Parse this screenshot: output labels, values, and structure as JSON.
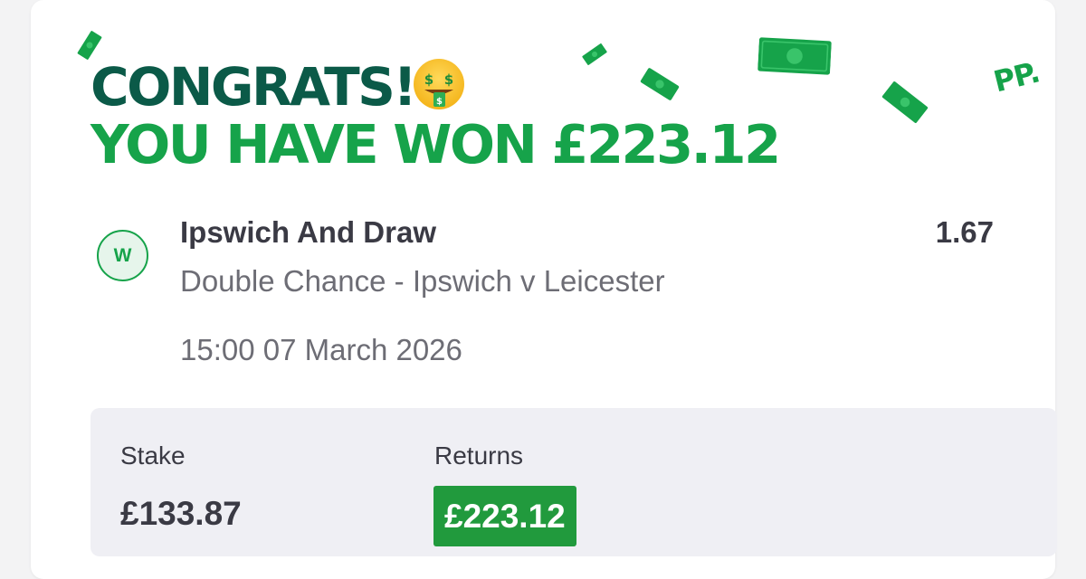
{
  "banner": {
    "line1": "CONGRATS!",
    "line2": "YOU HAVE WON £223.12",
    "emoji_icon": "money-mouth-face-icon",
    "decoration_icon": "banknote-icon",
    "logo_text": "PP."
  },
  "bet": {
    "status_badge": "W",
    "selection": "Ipswich And Draw",
    "odds": "1.67",
    "market": "Double Chance - Ipswich v Leicester",
    "datetime": "15:00 07 March 2026"
  },
  "summary": {
    "stake_label": "Stake",
    "stake_value": "£133.87",
    "returns_label": "Returns",
    "returns_value": "£223.12"
  },
  "colors": {
    "brand_dark": "#0b5a48",
    "brand_green": "#16a34a",
    "returns_badge": "#219a3d",
    "text": "#3a3a44",
    "muted_text": "#6d6d75"
  }
}
